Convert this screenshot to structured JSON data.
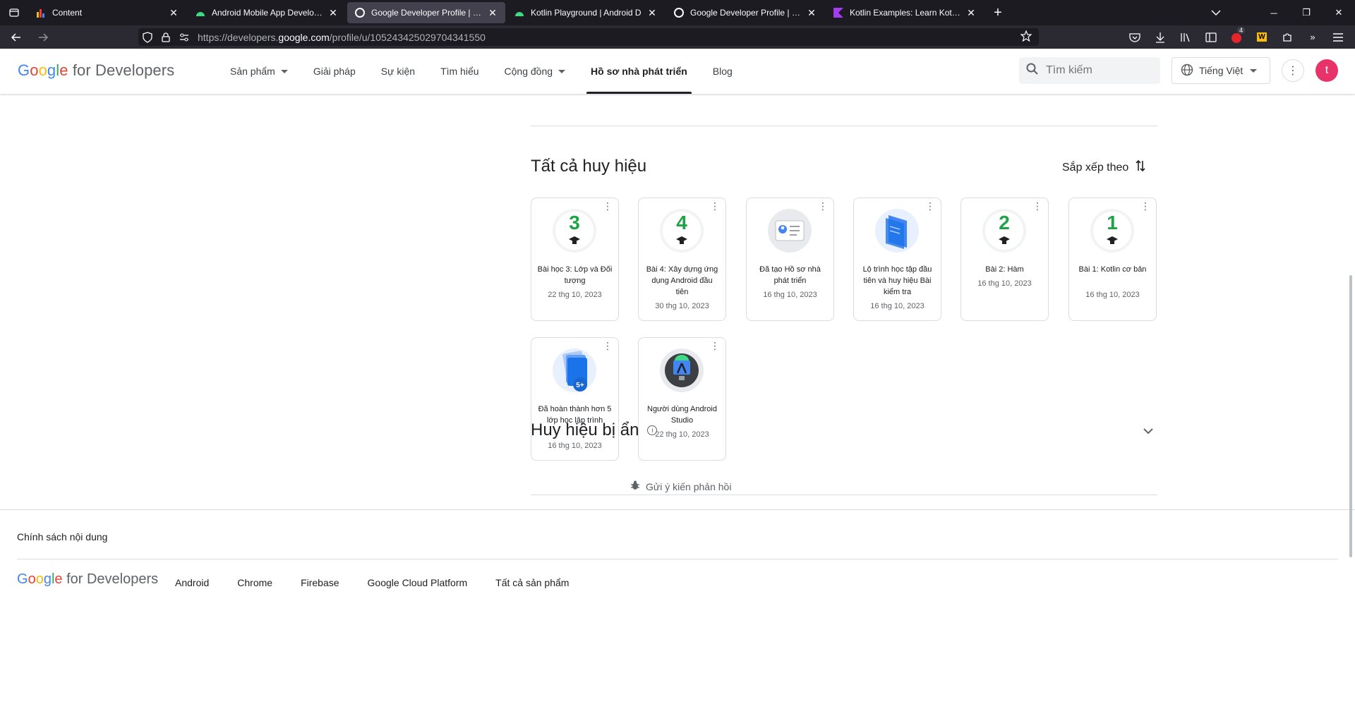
{
  "browser": {
    "tabs": [
      {
        "title": "Content",
        "icon": "chart-favicon",
        "active": false
      },
      {
        "title": "Android Mobile App Developer",
        "icon": "android-favicon",
        "active": false
      },
      {
        "title": "Google Developer Profile | Goo",
        "icon": "google-favicon",
        "active": true
      },
      {
        "title": "Kotlin Playground | Android D",
        "icon": "android-favicon",
        "active": false
      },
      {
        "title": "Google Developer Profile | Goo",
        "icon": "google-favicon",
        "active": false
      },
      {
        "title": "Kotlin Examples: Learn Kotlin P",
        "icon": "kotlin-favicon",
        "active": false
      }
    ],
    "url_prefix": "https://developers.",
    "url_domain": "google.com",
    "url_path": "/profile/u/105243425029704341550",
    "extension_badge": "4"
  },
  "header": {
    "logo_brand": "Google",
    "logo_suffix": "for Developers",
    "nav": [
      {
        "label": "Sản phẩm",
        "dropdown": true
      },
      {
        "label": "Giải pháp",
        "dropdown": false
      },
      {
        "label": "Sự kiện",
        "dropdown": false
      },
      {
        "label": "Tìm hiểu",
        "dropdown": false
      },
      {
        "label": "Cộng đồng",
        "dropdown": true
      },
      {
        "label": "Hồ sơ nhà phát triển",
        "dropdown": false,
        "active": true
      },
      {
        "label": "Blog",
        "dropdown": false
      }
    ],
    "search_placeholder": "Tìm kiếm",
    "language": "Tiếng Việt",
    "avatar_initial": "t"
  },
  "badges_section": {
    "title": "Tất cả huy hiệu",
    "sort_label": "Sắp xếp theo",
    "badges": [
      {
        "name": "Bài học 3: Lớp và Đối tượng",
        "date": "22 thg 10, 2023",
        "icon": "number-3-badge",
        "number": "3"
      },
      {
        "name": "Bài 4: Xây dựng ứng dụng Android đầu tiên",
        "date": "30 thg 10, 2023",
        "icon": "number-4-badge",
        "number": "4"
      },
      {
        "name": "Đã tạo Hồ sơ nhà phát triển",
        "date": "16 thg 10, 2023",
        "icon": "profile-card-badge"
      },
      {
        "name": "Lộ trình học tập đầu tiên và huy hiệu Bài kiểm tra",
        "date": "16 thg 10, 2023",
        "icon": "learning-path-badge"
      },
      {
        "name": "Bài 2: Hàm",
        "date": "16 thg 10, 2023",
        "icon": "number-2-badge",
        "number": "2"
      },
      {
        "name": "Bài 1: Kotlin cơ bản",
        "date": "16 thg 10, 2023",
        "icon": "number-1-badge",
        "number": "1"
      },
      {
        "name": "Đã hoàn thành hơn 5 lớp học lập trình",
        "date": "16 thg 10, 2023",
        "icon": "codelabs-5plus-badge",
        "number": "5+"
      },
      {
        "name": "Người dùng Android Studio",
        "date": "22 thg 10, 2023",
        "icon": "android-studio-badge"
      }
    ]
  },
  "hidden_section": {
    "title": "Huy hiệu bị ẩn"
  },
  "feedback": {
    "label": "Gửi ý kiến phản hồi"
  },
  "footer": {
    "policy": "Chính sách nội dung",
    "logo_brand": "Google",
    "logo_suffix": "for Developers",
    "links": [
      "Android",
      "Chrome",
      "Firebase",
      "Google Cloud Platform",
      "Tất cả sản phẩm"
    ]
  },
  "colors": {
    "green_badge": "#1ea446",
    "avatar": "#e8336a",
    "chrome_dark": "#1c1b22",
    "chrome_mid": "#2b2a33"
  }
}
